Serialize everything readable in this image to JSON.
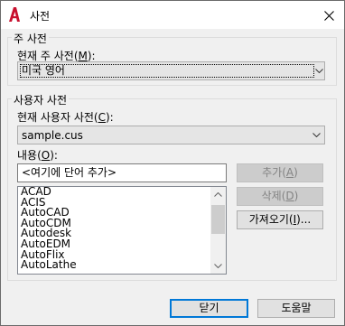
{
  "window": {
    "title": "사전"
  },
  "main_dictionary": {
    "group_title": "주 사전",
    "label": "현재 주 사전(M):",
    "selected": "미국 영어"
  },
  "user_dictionary": {
    "group_title": "사용자 사전",
    "label": "현재 사용자 사전(C):",
    "selected": "sample.cus",
    "content_label": "내용(O):",
    "content_input": "<여기에 단어 추가>",
    "words": [
      "ACAD",
      "ACIS",
      "AutoCAD",
      "AutoCDM",
      "Autodesk",
      "AutoEDM",
      "AutoFlix",
      "AutoLathe"
    ],
    "add_button": "추가(A)",
    "delete_button": "삭제(D)",
    "import_button": "가져오기(I)..."
  },
  "footer": {
    "close_button": "닫기",
    "help_button": "도움말"
  },
  "colors": {
    "app_icon": "#c8102e",
    "default_button_border": "#0078d7"
  }
}
